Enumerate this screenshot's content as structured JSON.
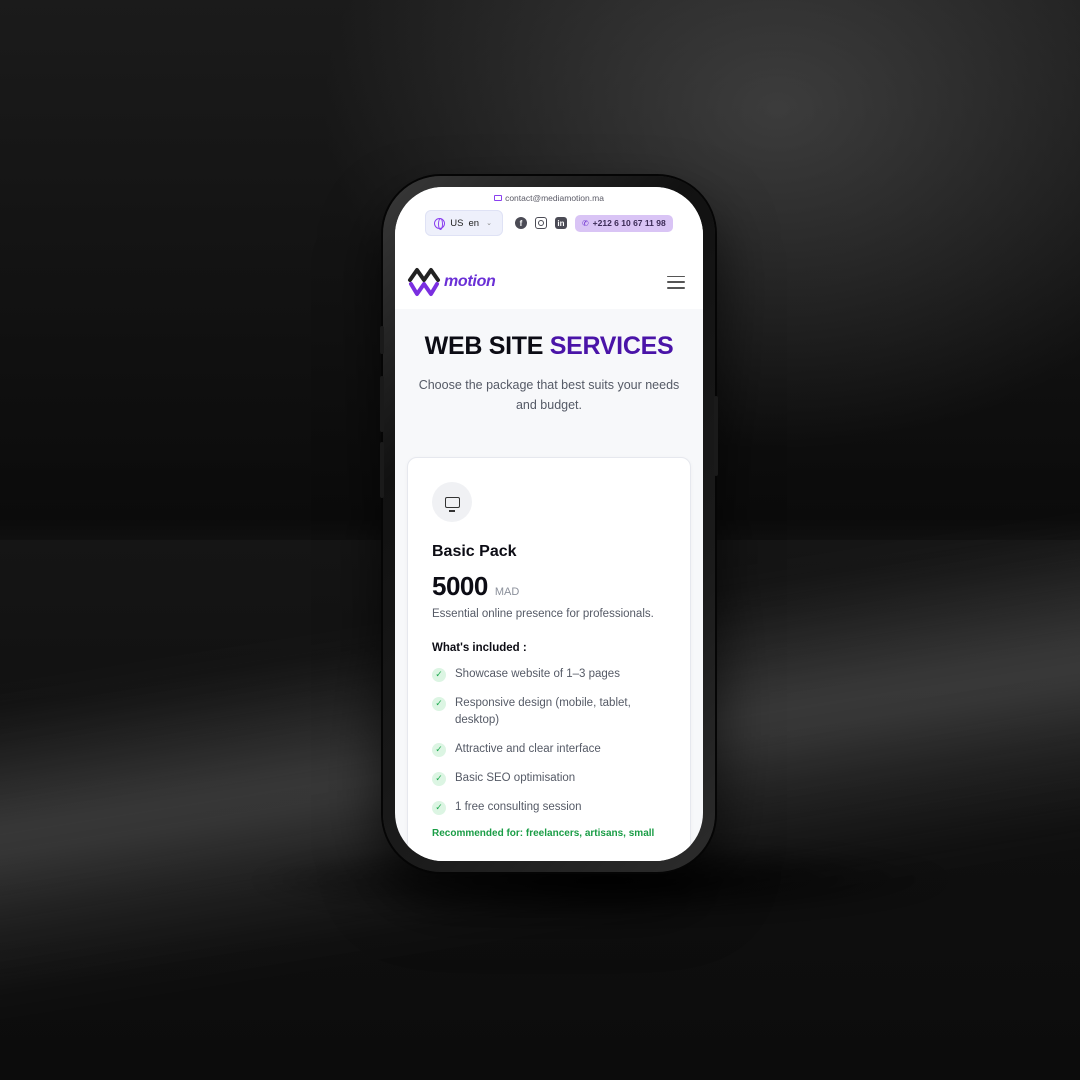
{
  "topbar": {
    "email": "contact@mediamotion.ma",
    "language": {
      "flag": "US",
      "code": "en"
    },
    "social_icons": [
      "facebook-icon",
      "instagram-icon",
      "linkedin-icon"
    ],
    "phone": "+212 6 10 67 11 98"
  },
  "navbar": {
    "logo_text": "motion"
  },
  "hero": {
    "title_part1": "WEB SITE ",
    "title_part2": "SERVICES",
    "subtitle": "Choose the package that best suits your needs and budget."
  },
  "card": {
    "icon": "monitor-icon",
    "name": "Basic Pack",
    "price": "5000",
    "currency": "MAD",
    "description": "Essential online presence for professionals.",
    "included_title": "What's included :",
    "features": [
      "Showcase website of 1–3 pages",
      "Responsive design (mobile, tablet, desktop)",
      "Attractive and clear interface",
      "Basic SEO optimisation",
      "1 free consulting session"
    ],
    "recommended": "Recommended for: freelancers, artisans, small"
  },
  "colors": {
    "brand_purple": "#4a14a8",
    "accent_purple": "#8a3ff0",
    "check_green": "#1faa4f",
    "recommended_green": "#1a9d46"
  }
}
